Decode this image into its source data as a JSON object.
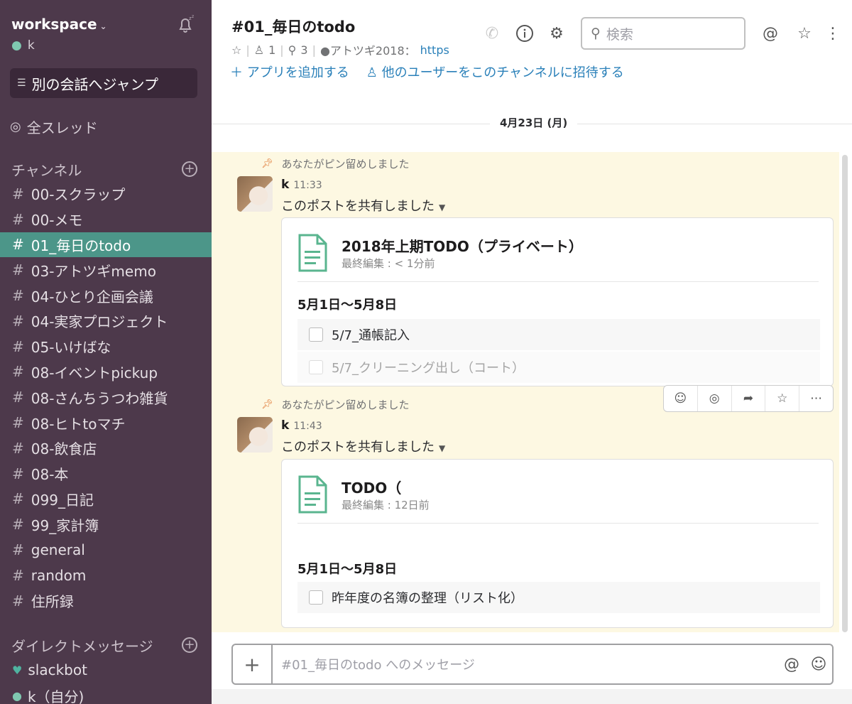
{
  "sidebar": {
    "workspace_name": "workspace",
    "user_name": "k",
    "jump_label": "別の会話へジャンプ",
    "threads_label": "全スレッド",
    "channels_header": "チャンネル",
    "channels": [
      {
        "name": "00-スクラップ",
        "active": false
      },
      {
        "name": "00-メモ",
        "active": false
      },
      {
        "name": "01_毎日のtodo",
        "active": true
      },
      {
        "name": "03-アトツギmemo",
        "active": false
      },
      {
        "name": "04-ひとり企画会議",
        "active": false
      },
      {
        "name": "04-実家プロジェクト",
        "active": false
      },
      {
        "name": "05-いけばな",
        "active": false
      },
      {
        "name": "08-イベントpickup",
        "active": false
      },
      {
        "name": "08-さんちうつわ雑貨",
        "active": false
      },
      {
        "name": "08-ヒトtoマチ",
        "active": false
      },
      {
        "name": "08-飲食店",
        "active": false
      },
      {
        "name": "08-本",
        "active": false
      },
      {
        "name": "099_日記",
        "active": false
      },
      {
        "name": "99_家計簿",
        "active": false
      },
      {
        "name": "general",
        "active": false
      },
      {
        "name": "random",
        "active": false
      },
      {
        "name": "住所録",
        "active": false
      }
    ],
    "dm_header": "ダイレクトメッセージ",
    "dms": [
      {
        "name": "slackbot",
        "icon": "heart-icon"
      },
      {
        "name": "k（自分)",
        "icon": "presence-icon"
      }
    ]
  },
  "header": {
    "channel_title": "#01_毎日のtodo",
    "members": "1",
    "pins": "3",
    "topic": "●アトツギ2018：",
    "topic_link": "https",
    "search_placeholder": "検索"
  },
  "actions": {
    "add_app": "アプリを追加する",
    "invite": "他のユーザーをこのチャンネルに招待する"
  },
  "date_divider": "4月23日 (月)",
  "messages": [
    {
      "pin_note": "あなたがピン留めしました",
      "author": "k",
      "time": "11:33",
      "text": "このポストを共有しました",
      "card": {
        "title": "2018年上期TODO（プライベート）",
        "subtitle": "最終編集 : < 1分前",
        "section": "5月1日〜5月8日",
        "todos": [
          "5/7_通帳記入",
          "5/7_クリーニング出し（コート）"
        ]
      }
    },
    {
      "pin_note": "あなたがピン留めしました",
      "author": "k",
      "time": "11:43",
      "text": "このポストを共有しました",
      "card": {
        "title": "TODO（",
        "subtitle": "最終編集 : 12日前",
        "section": "5月1日〜5月8日",
        "todos": [
          "昨年度の名簿の整理（リスト化）"
        ]
      }
    }
  ],
  "composer": {
    "placeholder": "#01_毎日のtodo へのメッセージ"
  },
  "colors": {
    "sidebar_bg": "#4d394b",
    "active_channel": "#4c9689",
    "link": "#2a80b9",
    "pinned_bg": "#fdf8e2"
  }
}
